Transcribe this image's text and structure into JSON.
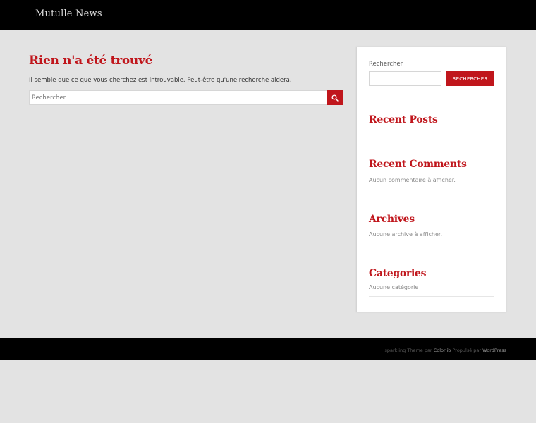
{
  "header": {
    "site_title": "Mutulle News"
  },
  "main": {
    "title": "Rien n'a été trouvé",
    "message": "Il semble que ce que vous cherchez est introuvable. Peut-être qu'une recherche aidera.",
    "search_placeholder": "Rechercher"
  },
  "sidebar": {
    "search_label": "Rechercher",
    "search_button": "RECHERCHER",
    "recent_posts_title": "Recent Posts",
    "recent_comments_title": "Recent Comments",
    "recent_comments_text": "Aucun commentaire à afficher.",
    "archives_title": "Archives",
    "archives_text": "Aucune archive à afficher.",
    "categories_title": "Categories",
    "categories_text": "Aucune catégorie"
  },
  "footer": {
    "theme_name": "sparkling",
    "theme_word": "Theme par",
    "theme_author": "Colorlib",
    "powered": "Propulsé par",
    "platform": "WordPress"
  },
  "colors": {
    "accent": "#c0161c",
    "bar": "#000000",
    "page_bg": "#e3e3e3"
  },
  "icons": {
    "search_button_icon": "search-icon"
  }
}
